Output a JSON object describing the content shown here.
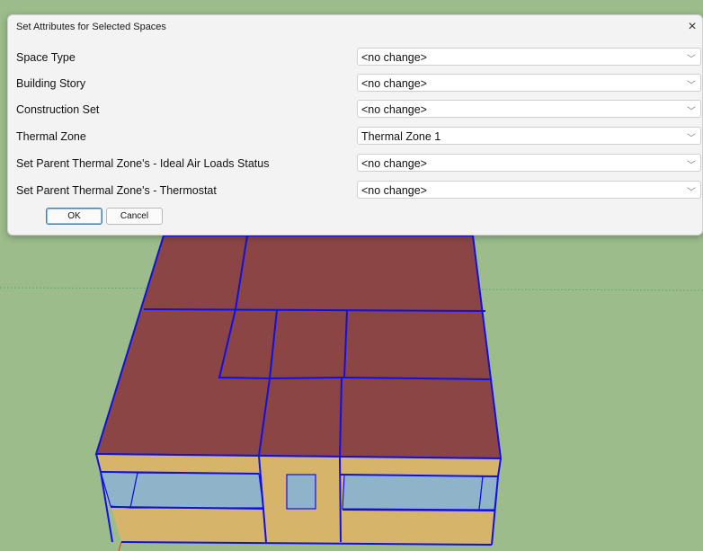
{
  "dialog": {
    "title": "Set Attributes for Selected Spaces",
    "close_glyph": "×",
    "rows": [
      {
        "label": "Space Type",
        "value": "<no change>"
      },
      {
        "label": "Building Story",
        "value": "<no change>"
      },
      {
        "label": "Construction Set",
        "value": "<no change>"
      },
      {
        "label": "Thermal Zone",
        "value": "Thermal Zone 1"
      },
      {
        "label": "Set Parent Thermal Zone's - Ideal Air Loads Status",
        "value": "<no change>"
      },
      {
        "label": "Set Parent Thermal Zone's - Thermostat",
        "value": "<no change>"
      }
    ],
    "ok_label": "OK",
    "cancel_label": "Cancel",
    "chevron_glyph": "﹀"
  },
  "colors": {
    "ground": "#9cbc8c",
    "roof": "#8b4545",
    "wall": "#d6b56b",
    "glass": "#8fb4c9",
    "edge": "#1010e6"
  }
}
